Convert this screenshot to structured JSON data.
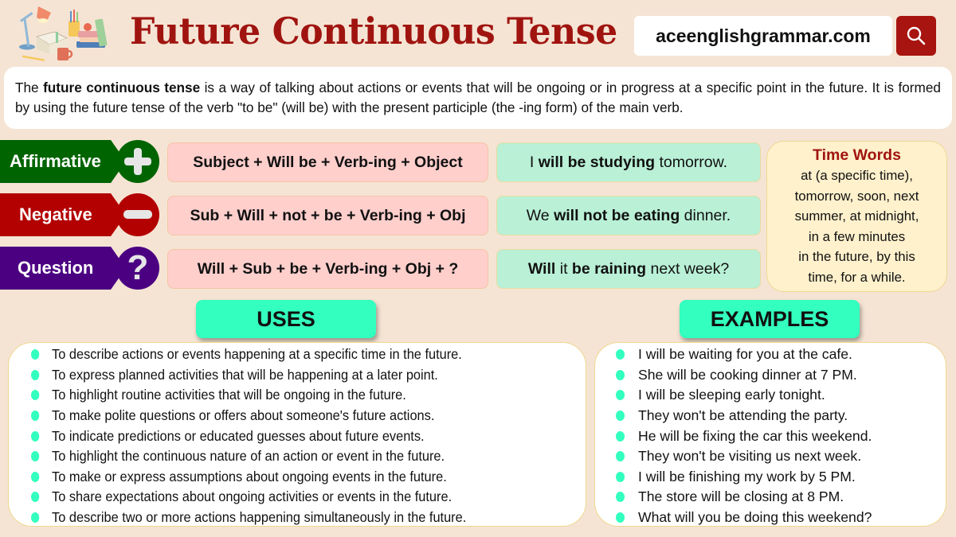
{
  "header": {
    "title": "Future Continuous Tense",
    "site": "aceenglishgrammar.com",
    "search_icon": "search-icon",
    "logo": "study-desk-illustration"
  },
  "intro": {
    "pre": "The ",
    "bold": "future continuous tense",
    "post": " is a way of talking about actions or events that will be ongoing or in progress at a specific point in the future. It is formed by using the future tense of the verb \"to be\" (will be) with the present participle (the -ing form) of the main verb."
  },
  "forms": [
    {
      "label": "Affirmative",
      "icon": "plus-icon",
      "color": "#006400",
      "formula": "Subject + Will be + Verb-ing + Object",
      "example": [
        {
          "text": "I ",
          "bold": false
        },
        {
          "text": "will be studying",
          "bold": true
        },
        {
          "text": " tomorrow.",
          "bold": false
        }
      ]
    },
    {
      "label": "Negative",
      "icon": "minus-icon",
      "color": "#b30000",
      "formula": "Sub + Will + not + be + Verb-ing + Obj",
      "example": [
        {
          "text": "We ",
          "bold": false
        },
        {
          "text": "will not be eating",
          "bold": true
        },
        {
          "text": " dinner.",
          "bold": false
        }
      ]
    },
    {
      "label": "Question",
      "icon": "question-icon",
      "color": "#4b0082",
      "formula": "Will + Sub + be + Verb-ing + Obj + ?",
      "example": [
        {
          "text": "Will",
          "bold": true
        },
        {
          "text": " it ",
          "bold": false
        },
        {
          "text": "be raining",
          "bold": true
        },
        {
          "text": " next week?",
          "bold": false
        }
      ]
    }
  ],
  "time_words": {
    "title": "Time Words",
    "lines": [
      "at (a specific time),",
      "tomorrow, soon, next",
      "summer, at midnight,",
      "in a few minutes",
      "in the future, by this",
      "time, for a while."
    ]
  },
  "uses": {
    "heading": "USES",
    "items": [
      "To describe actions or events happening at a specific time in the future.",
      "To express planned activities that will be happening at a later point.",
      "To highlight routine activities that will be ongoing in the future.",
      "To make polite questions or offers about someone's future actions.",
      "To indicate predictions or educated guesses about future events.",
      "To highlight the continuous nature of an action or event in the future.",
      "To make or express assumptions about ongoing events in the future.",
      "To share expectations about ongoing activities or events in the future.",
      "To describe two or more actions happening simultaneously in the future."
    ]
  },
  "examples": {
    "heading": "EXAMPLES",
    "items": [
      "I will be waiting for you at the cafe.",
      "She will be cooking dinner at 7 PM.",
      "I will be sleeping early tonight.",
      "They won't be attending the party.",
      "He will be fixing the car this weekend.",
      "They won't be visiting us next week.",
      "I will be finishing my work by 5 PM.",
      "The store will be closing at 8 PM.",
      "What will you be doing this weekend?"
    ]
  },
  "colors": {
    "title": "#a01410",
    "accent_teal": "#33ffbe",
    "formula_bg": "#ffcfcc",
    "example_bg": "#b9f0d6",
    "timewords_bg": "#fff1cc",
    "page_bg": "#f5e4d4"
  }
}
